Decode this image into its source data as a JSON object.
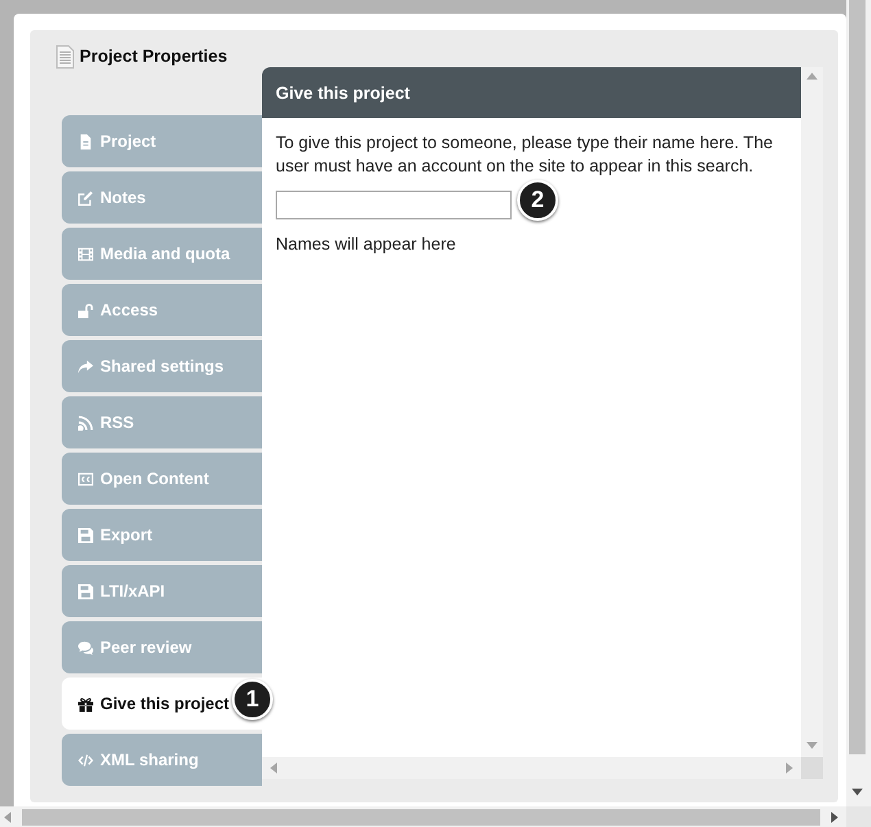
{
  "dialog": {
    "title": "Project Properties"
  },
  "tabs": [
    {
      "label": "Project",
      "selected": false
    },
    {
      "label": "Notes",
      "selected": false
    },
    {
      "label": "Media and quota",
      "selected": false
    },
    {
      "label": "Access",
      "selected": false
    },
    {
      "label": "Shared settings",
      "selected": false
    },
    {
      "label": "RSS",
      "selected": false
    },
    {
      "label": "Open Content",
      "selected": false
    },
    {
      "label": "Export",
      "selected": false
    },
    {
      "label": "LTI/xAPI",
      "selected": false
    },
    {
      "label": "Peer review",
      "selected": false
    },
    {
      "label": "Give this project",
      "selected": true,
      "callout": "1"
    },
    {
      "label": "XML sharing",
      "selected": false
    }
  ],
  "panel": {
    "title": "Give this project",
    "description": "To give this project to someone, please type their name here. The user must have an account on the site to appear in this search.",
    "search_field": {
      "callout": "2"
    },
    "results_hint": "Names will appear here"
  }
}
